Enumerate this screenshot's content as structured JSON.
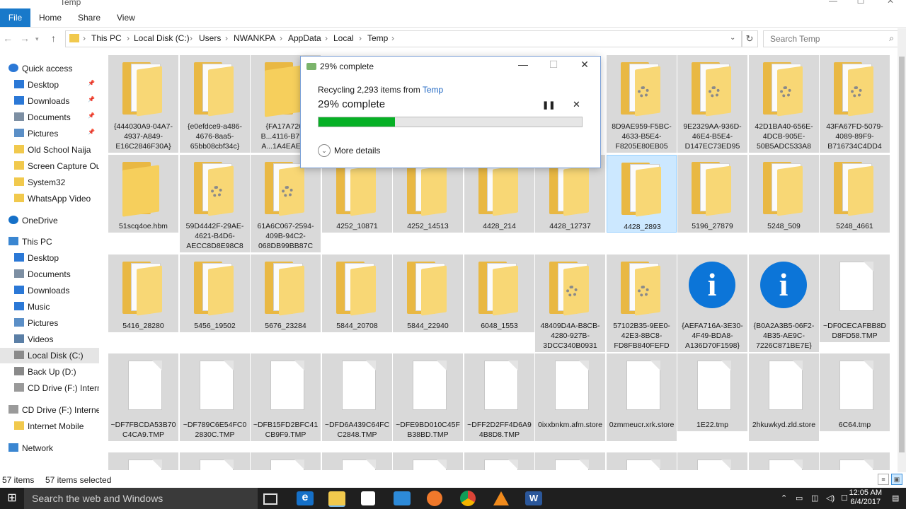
{
  "window": {
    "title": "Temp"
  },
  "ribbon": {
    "file": "File",
    "tabs": [
      "Home",
      "Share",
      "View"
    ]
  },
  "address": {
    "segments": [
      "This PC",
      "Local Disk (C:)",
      "Users",
      "NWANKPA",
      "AppData",
      "Local",
      "Temp"
    ],
    "separator": "›",
    "search_placeholder": "Search Temp"
  },
  "nav": {
    "items": [
      {
        "label": "Quick access",
        "icon": "star-icon"
      },
      {
        "label": "Desktop",
        "icon": "desktop-icon",
        "pinned": true
      },
      {
        "label": "Downloads",
        "icon": "download-icon",
        "pinned": true
      },
      {
        "label": "Documents",
        "icon": "documents-icon",
        "pinned": true
      },
      {
        "label": "Pictures",
        "icon": "pictures-icon",
        "pinned": true
      },
      {
        "label": "Old School Naija",
        "icon": "folder-icon"
      },
      {
        "label": "Screen Capture Out",
        "icon": "folder-icon"
      },
      {
        "label": "System32",
        "icon": "folder-icon"
      },
      {
        "label": "WhatsApp Video",
        "icon": "folder-icon"
      },
      {
        "label": "OneDrive",
        "icon": "cloud-icon"
      },
      {
        "label": "This PC",
        "icon": "computer-icon"
      },
      {
        "label": "Desktop",
        "icon": "desktop-icon"
      },
      {
        "label": "Documents",
        "icon": "documents-icon"
      },
      {
        "label": "Downloads",
        "icon": "download-icon"
      },
      {
        "label": "Music",
        "icon": "music-icon"
      },
      {
        "label": "Pictures",
        "icon": "pictures-icon"
      },
      {
        "label": "Videos",
        "icon": "videos-icon"
      },
      {
        "label": "Local Disk (C:)",
        "icon": "drive-icon",
        "selected": true
      },
      {
        "label": "Back Up (D:)",
        "icon": "drive-icon"
      },
      {
        "label": "CD Drive (F:) Interne",
        "icon": "cd-drive-icon"
      },
      {
        "label": "CD Drive (F:) Internet",
        "icon": "cd-drive-icon"
      },
      {
        "label": "Internet Mobile",
        "icon": "folder-icon"
      },
      {
        "label": "Network",
        "icon": "network-icon"
      }
    ]
  },
  "files": [
    {
      "name": "{444030A9-04A7-4937-A849-E16C2846F30A}",
      "kind": "folder-doc"
    },
    {
      "name": "{e0efdce9-a486-4676-8aa5-65bb08cbf34c}",
      "kind": "folder-doc"
    },
    {
      "name": "{FA17A726-B...4116-B793-A...1A4EAE2E",
      "kind": "folder"
    },
    {
      "name": "",
      "kind": "hidden"
    },
    {
      "name": "",
      "kind": "hidden"
    },
    {
      "name": "",
      "kind": "hidden"
    },
    {
      "name": "",
      "kind": "hidden"
    },
    {
      "name": "8D9AE959-F5BC-4633-B5E4-F8205E80EB05",
      "kind": "folder-gear"
    },
    {
      "name": "9E2329AA-936D-46E4-B5E4-D147EC73ED95",
      "kind": "folder-gear"
    },
    {
      "name": "42D1BA40-656E-4DCB-905E-50B5ADC533A8",
      "kind": "folder-gear"
    },
    {
      "name": "43FA67FD-5079-4089-89F9-B716734C4DD4",
      "kind": "folder-gear"
    },
    {
      "name": "51scq4oe.hbm",
      "kind": "folder"
    },
    {
      "name": "59D4442F-29AE-4621-B4D6-AECC8D8E98C8",
      "kind": "folder-gear"
    },
    {
      "name": "61A6C067-2594-409B-94C2-068DB99BB87C",
      "kind": "folder-gear"
    },
    {
      "name": "4252_10871",
      "kind": "folder-doc"
    },
    {
      "name": "4252_14513",
      "kind": "folder-doc"
    },
    {
      "name": "4428_214",
      "kind": "folder-doc"
    },
    {
      "name": "4428_12737",
      "kind": "folder-doc"
    },
    {
      "name": "4428_2893",
      "kind": "folder-doc",
      "highlight": true
    },
    {
      "name": "5196_27879",
      "kind": "folder-doc"
    },
    {
      "name": "5248_509",
      "kind": "folder-doc"
    },
    {
      "name": "5248_4661",
      "kind": "folder-doc"
    },
    {
      "name": "5416_28280",
      "kind": "folder-doc"
    },
    {
      "name": "5456_19502",
      "kind": "folder-doc"
    },
    {
      "name": "5676_23284",
      "kind": "folder-doc"
    },
    {
      "name": "5844_20708",
      "kind": "folder-doc"
    },
    {
      "name": "5844_22940",
      "kind": "folder-doc"
    },
    {
      "name": "6048_1553",
      "kind": "folder-doc"
    },
    {
      "name": "48409D4A-B8CB-4280-927B-3DCC340B0931",
      "kind": "folder-gear"
    },
    {
      "name": "57102B35-9EE0-42E3-8BC8-FD8FB840FEFD",
      "kind": "folder-gear"
    },
    {
      "name": "{AEFA716A-3E30-4F49-BDA8-A136D70F1598}",
      "kind": "info"
    },
    {
      "name": "{B0A2A3B5-06F2-4B35-AE9C-7226C871BE7E}",
      "kind": "info"
    },
    {
      "name": "~DF0CECAFBB8DD8FD58.TMP",
      "kind": "file"
    },
    {
      "name": "~DF7FBCDA53B70C4CA9.TMP",
      "kind": "file"
    },
    {
      "name": "~DF789C6E54FC02830C.TMP",
      "kind": "file"
    },
    {
      "name": "~DFB15FD2BFC41CB9F9.TMP",
      "kind": "file"
    },
    {
      "name": "~DFD6A439C64FCC2848.TMP",
      "kind": "file"
    },
    {
      "name": "~DFE9BD010C45FB38BD.TMP",
      "kind": "file"
    },
    {
      "name": "~DFF2D2FF4D6A94B8D8.TMP",
      "kind": "file"
    },
    {
      "name": "0ixxbnkm.afm.store",
      "kind": "file"
    },
    {
      "name": "0zmmeucr.xrk.store",
      "kind": "file"
    },
    {
      "name": "1E22.tmp",
      "kind": "file"
    },
    {
      "name": "2hkuwkyd.zld.store",
      "kind": "file"
    },
    {
      "name": "6C64.tmp",
      "kind": "file"
    },
    {
      "name": "",
      "kind": "file"
    },
    {
      "name": "",
      "kind": "file"
    },
    {
      "name": "",
      "kind": "file"
    },
    {
      "name": "",
      "kind": "file"
    },
    {
      "name": "",
      "kind": "file"
    },
    {
      "name": "",
      "kind": "file"
    },
    {
      "name": "",
      "kind": "file"
    },
    {
      "name": "",
      "kind": "file"
    },
    {
      "name": "",
      "kind": "file"
    },
    {
      "name": "",
      "kind": "file"
    },
    {
      "name": "",
      "kind": "file"
    },
    {
      "name": "",
      "kind": "file"
    }
  ],
  "dialog": {
    "title": "29% complete",
    "line_prefix": "Recycling 2,293 items from ",
    "line_link": "Temp",
    "percent_text": "29% complete",
    "progress": 0.29,
    "more_details": "More details",
    "pause_icon": "pause-icon",
    "close_icon": "close-icon"
  },
  "status": {
    "items_count": "57 items",
    "selected_count": "57 items selected"
  },
  "taskbar": {
    "search_placeholder": "Search the web and Windows",
    "time": "12:05 AM",
    "date": "6/4/2017"
  }
}
